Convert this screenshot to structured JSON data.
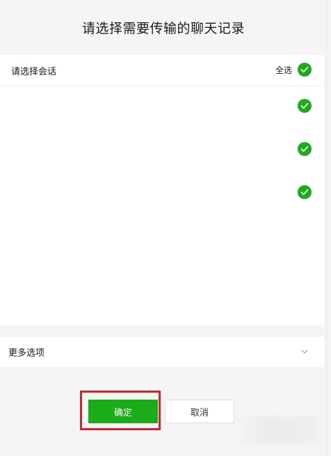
{
  "dialog": {
    "title": "请选择需要传输的聊天记录"
  },
  "list": {
    "header_label": "请选择会话",
    "select_all_label": "全选",
    "select_all_checked": true,
    "items": [
      {
        "checked": true
      },
      {
        "checked": true
      },
      {
        "checked": true
      }
    ]
  },
  "more_options": {
    "label": "更多选项",
    "icon": "chevron-down-icon"
  },
  "buttons": {
    "confirm_label": "确定",
    "cancel_label": "取消"
  },
  "colors": {
    "accent_green": "#1aad19",
    "highlight_red": "#d6202a",
    "background": "#f5f5f5"
  }
}
